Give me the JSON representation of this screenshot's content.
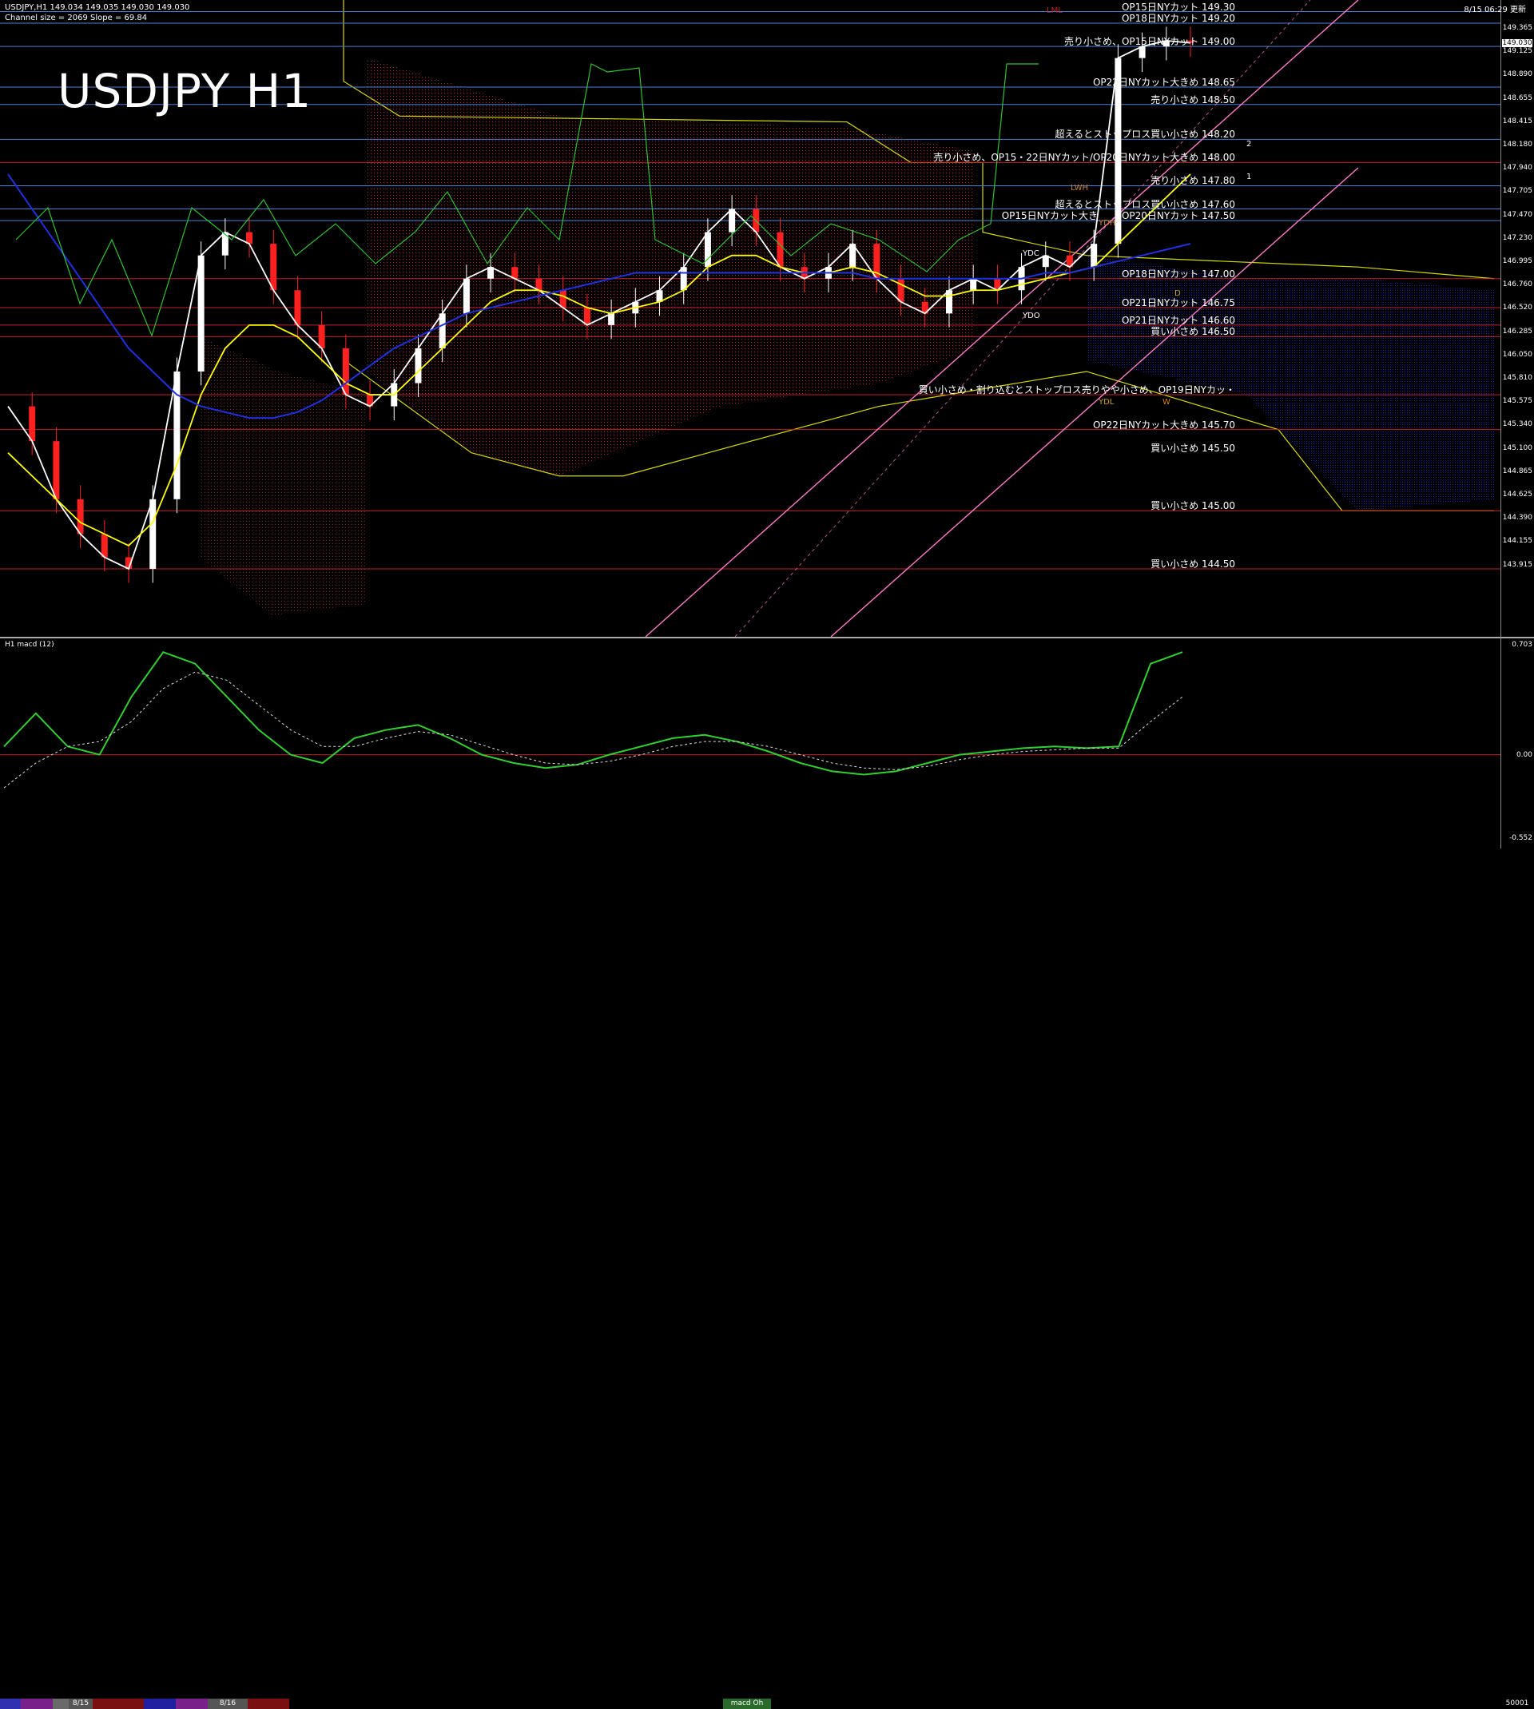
{
  "header": {
    "symbol_line": "USDJPY,H1  149.034 149.035 149.030 149.030",
    "channel_line": "Channel size = 2069 Slope = 69.84",
    "timestamp": "8/15 06:29 更新",
    "big_title": "USDJPY H1"
  },
  "macd_panel": {
    "label": "H1  macd (12)",
    "axis": [
      "0.703",
      "0.00",
      "-0.552"
    ]
  },
  "bottom_bar": {
    "tabs": [
      "8/15",
      "8/16",
      "macd Oh",
      "50001"
    ]
  },
  "price_axis": {
    "ticks": [
      "149.365",
      "149.125",
      "148.890",
      "148.655",
      "148.415",
      "148.180",
      "147.940",
      "147.705",
      "147.470",
      "147.230",
      "146.995",
      "146.760",
      "146.520",
      "146.285",
      "146.050",
      "145.810",
      "145.575",
      "145.340",
      "145.100",
      "144.865",
      "144.625",
      "144.390",
      "144.155",
      "143.915"
    ],
    "current": "149.030"
  },
  "annotations": [
    {
      "text": "OP15日NYカット 149.30",
      "price": 149.3
    },
    {
      "text": "OP18日NYカット 149.20",
      "price": 149.2
    },
    {
      "text": "売り小さめ、OP15日NYカット 149.00",
      "price": 149.0
    },
    {
      "text": "OP22日NYカット大きめ 148.65",
      "price": 148.65
    },
    {
      "text": "売り小さめ 148.50",
      "price": 148.5
    },
    {
      "text": "超えるとストップロス買い小さめ 148.20",
      "price": 148.2
    },
    {
      "text": "売り小さめ、OP15・22日NYカット/OP20日NYカット大きめ 148.00",
      "price": 148.0
    },
    {
      "text": "売り小さめ 147.80",
      "price": 147.8
    },
    {
      "text": "超えるとストップロス買い小さめ 147.60",
      "price": 147.6
    },
    {
      "text": "OP15日NYカット大き",
      "price": 147.5,
      "left": true
    },
    {
      "text": "OP20日NYカット 147.50",
      "price": 147.5
    },
    {
      "text": "OP18日NYカット 147.00",
      "price": 147.0
    },
    {
      "text": "OP21日NYカット 146.75",
      "price": 146.75
    },
    {
      "text": "OP21日NYカット 146.60",
      "price": 146.6
    },
    {
      "text": "買い小さめ 146.50",
      "price": 146.5
    },
    {
      "text": "買い小さめ・割り込むとストップロス売りやや小さめ、OP19日NYカッ・",
      "price": 146.0
    },
    {
      "text": "OP22日NYカット大きめ 145.70",
      "price": 145.7
    },
    {
      "text": "買い小さめ 145.50",
      "price": 145.5
    },
    {
      "text": "買い小さめ 145.00",
      "price": 145.0
    },
    {
      "text": "買い小さめ 144.50",
      "price": 144.5
    }
  ],
  "box_labels": [
    "LML",
    "LWH",
    "YDH",
    "YDC",
    "YDO",
    "YDL",
    "W",
    "D",
    "1",
    "2"
  ],
  "colors": {
    "bg": "#000000",
    "blue_level": "#4a7fd4",
    "red_level": "#c0202a",
    "yellow": "#ffff00",
    "white": "#ffffff",
    "blue_ma": "#2030e0",
    "green": "#30c030",
    "pink": "#ff7ac8",
    "kumo": "#c0302a",
    "cloud_blue": "#2030b0",
    "macd_green": "#30d030",
    "macd_pink": "#f08090"
  },
  "chart_data": {
    "type": "line",
    "symbol": "USDJPY",
    "timeframe": "H1",
    "ylim": [
      143.915,
      149.4
    ],
    "x_tick_labels": [
      "8/15",
      "8/16"
    ],
    "series": [
      {
        "values": [
          145.9,
          145.6,
          145.1,
          144.8,
          144.6,
          144.5,
          145.1,
          146.2,
          147.2,
          147.4,
          147.3,
          146.9,
          146.6,
          146.4,
          146.0,
          145.9,
          146.1,
          146.4,
          146.7,
          147.0,
          147.1,
          147.0,
          146.9,
          146.75,
          146.6,
          146.7,
          146.8,
          146.9,
          147.1,
          147.4,
          147.6,
          147.4,
          147.1,
          147.0,
          147.1,
          147.3,
          147.0,
          146.8,
          146.7,
          146.9,
          147.0,
          146.9,
          147.1,
          147.2,
          147.1,
          147.3,
          148.9,
          149.0,
          149.05,
          149.03
        ]
      },
      {
        "values": [
          145.5,
          145.3,
          145.1,
          144.9,
          144.8,
          144.7,
          144.9,
          145.4,
          146.0,
          146.4,
          146.6,
          146.6,
          146.5,
          146.3,
          146.1,
          146.0,
          146.0,
          146.2,
          146.4,
          146.6,
          146.8,
          146.9,
          146.9,
          146.85,
          146.75,
          146.7,
          146.75,
          146.8,
          146.9,
          147.1,
          147.2,
          147.2,
          147.1,
          147.05,
          147.05,
          147.1,
          147.05,
          146.95,
          146.85,
          146.85,
          146.9,
          146.9,
          146.95,
          147.0,
          147.05,
          147.1,
          147.3,
          147.5,
          147.7,
          147.9
        ]
      },
      {
        "values": [
          147.9,
          147.6,
          147.3,
          147.0,
          146.7,
          146.4,
          146.2,
          146.0,
          145.9,
          145.85,
          145.8,
          145.8,
          145.85,
          145.95,
          146.1,
          146.25,
          146.4,
          146.5,
          146.6,
          146.7,
          146.75,
          146.8,
          146.85,
          146.9,
          146.95,
          147.0,
          147.05,
          147.05,
          147.05,
          147.05,
          147.05,
          147.05,
          147.05,
          147.05,
          147.05,
          147.05,
          147.0,
          147.0,
          147.0,
          147.0,
          147.0,
          147.0,
          147.0,
          147.05,
          147.05,
          147.1,
          147.15,
          147.2,
          147.25,
          147.3
        ]
      }
    ],
    "macd": {
      "ylim": [
        -0.552,
        0.703
      ],
      "values": [
        0.05,
        0.25,
        0.05,
        0.0,
        0.35,
        0.62,
        0.55,
        0.35,
        0.15,
        0.0,
        -0.05,
        0.1,
        0.15,
        0.18,
        0.1,
        0.0,
        -0.05,
        -0.08,
        -0.06,
        0.0,
        0.05,
        0.1,
        0.12,
        0.08,
        0.02,
        -0.05,
        -0.1,
        -0.12,
        -0.1,
        -0.05,
        0.0,
        0.02,
        0.04,
        0.05,
        0.04,
        0.05,
        0.55,
        0.62
      ],
      "signal": [
        -0.2,
        -0.05,
        0.05,
        0.08,
        0.2,
        0.4,
        0.5,
        0.45,
        0.3,
        0.15,
        0.05,
        0.05,
        0.1,
        0.14,
        0.12,
        0.06,
        0.0,
        -0.05,
        -0.06,
        -0.04,
        0.0,
        0.05,
        0.08,
        0.08,
        0.05,
        0.0,
        -0.05,
        -0.08,
        -0.09,
        -0.07,
        -0.03,
        0.0,
        0.02,
        0.03,
        0.04,
        0.04,
        0.2,
        0.35
      ]
    }
  }
}
